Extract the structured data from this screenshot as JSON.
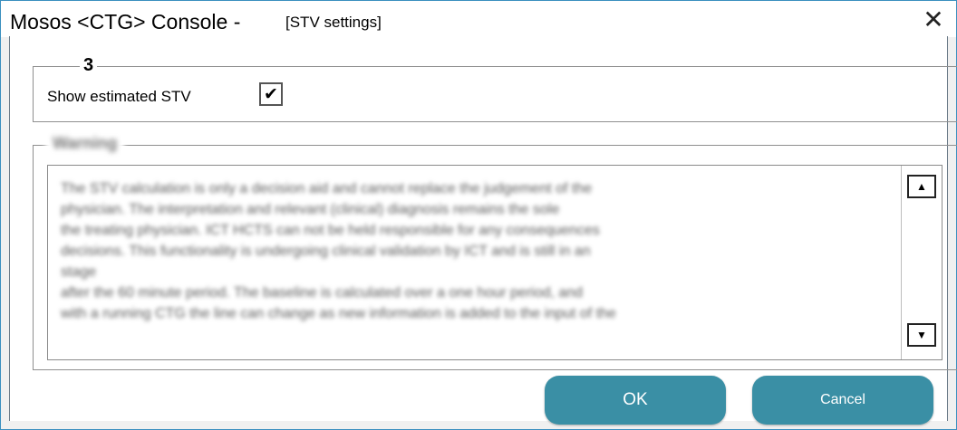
{
  "window": {
    "title": "Mosos <CTG> Console - ",
    "subtitle": "[STV settings]",
    "close_glyph": "✕"
  },
  "group_estimated": {
    "legend": "3",
    "option_label": "Show estimated STV",
    "checked": true,
    "check_glyph": "✔"
  },
  "group_disclaimer": {
    "legend": "Warning",
    "text_lines": [
      "The STV calculation is only a decision aid and cannot replace the judgement of the",
      "physician. The interpretation and relevant (clinical) diagnosis remains the sole",
      "the treating physician. ICT HCTS can not be held responsible for any consequences",
      "decisions. This functionality is undergoing clinical validation by ICT and is still in an",
      "stage",
      "after the 60 minute period. The baseline is calculated over a one hour period, and",
      "with a running CTG the line can change as new information is added to the input of the"
    ],
    "scroll_up_glyph": "▲",
    "scroll_down_glyph": "▼"
  },
  "buttons": {
    "ok_label": "OK",
    "cancel_label": "Cancel"
  },
  "colors": {
    "button": "#3a8fa5",
    "window_border": "#3a8fbf"
  }
}
